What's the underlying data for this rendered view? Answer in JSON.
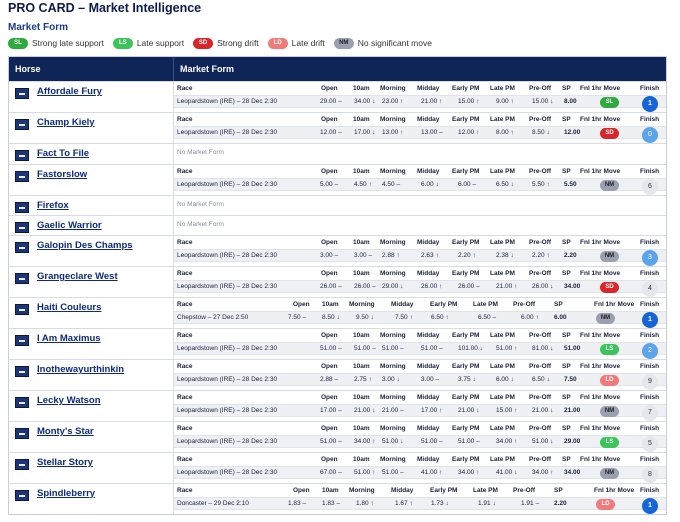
{
  "title": "PRO CARD – Market Intelligence",
  "subtitle": "Market Form",
  "legend": [
    {
      "code": "SL",
      "label": "Strong late support"
    },
    {
      "code": "LS",
      "label": "Late support"
    },
    {
      "code": "SD",
      "label": "Strong drift"
    },
    {
      "code": "LD",
      "label": "Late drift"
    },
    {
      "code": "NM",
      "label": "No significant move"
    }
  ],
  "table": {
    "col_horse": "Horse",
    "col_form": "Market Form",
    "sub_headers": [
      "Race",
      "Open",
      "10am",
      "Morning",
      "Midday",
      "Early PM",
      "Late PM",
      "Pre-Off",
      "SP",
      "Fnl 1hr Move",
      "Finish"
    ],
    "no_form_text": "No Market Form",
    "rows": [
      {
        "horse": "Affordale Fury",
        "race": "Leopardstown (IRE) – 28 Dec 2:30",
        "prices": [
          "29.00 –",
          "34.00 ↓",
          "23.00 ↑",
          "21.00 ↑",
          "15.00 ↑",
          "9.00 ↑",
          "15.00 ↓"
        ],
        "sp": "8.00",
        "move": "SL",
        "finish": "1"
      },
      {
        "horse": "Champ Kiely",
        "race": "Leopardstown (IRE) – 28 Dec 2:30",
        "prices": [
          "12.00 –",
          "17.00 ↓",
          "13.00 ↑",
          "13.00 –",
          "12.00 ↑",
          "8.00 ↑",
          "8.50 ↓"
        ],
        "sp": "12.00",
        "move": "SD",
        "finish": "0"
      },
      {
        "horse": "Fact To File",
        "noform": true
      },
      {
        "horse": "Fastorslow",
        "race": "Leopardstown (IRE) – 28 Dec 2:30",
        "prices": [
          "5.00 –",
          "4.50 ↑",
          "4.50 –",
          "6.00 ↓",
          "6.00 –",
          "6.50 ↓",
          "5.50 ↑"
        ],
        "sp": "5.50",
        "move": "NM",
        "finish": "6"
      },
      {
        "horse": "Firefox",
        "noform": true
      },
      {
        "horse": "Gaelic Warrior",
        "noform": true
      },
      {
        "horse": "Galopin Des Champs",
        "race": "Leopardstown (IRE) – 28 Dec 2:30",
        "prices": [
          "3.00 –",
          "3.00 –",
          "2.88 ↑",
          "2.63 ↑",
          "2.20 ↑",
          "2.38 ↓",
          "2.20 ↑"
        ],
        "sp": "2.20",
        "move": "NM",
        "finish": "3"
      },
      {
        "horse": "Grangeclare West",
        "race": "Leopardstown (IRE) – 28 Dec 2:30",
        "prices": [
          "26.00 –",
          "26.00 –",
          "29.00 ↓",
          "26.00 ↑",
          "26.00 –",
          "21.00 ↑",
          "26.00 ↓"
        ],
        "sp": "34.00",
        "move": "SD",
        "finish": "4"
      },
      {
        "horse": "Haiti Couleurs",
        "race": "Chepstow – 27 Dec 2:50",
        "prices": [
          "7.50 –",
          "8.50 ↓",
          "9.50 ↓",
          "7.50 ↑",
          "6.50 ↑",
          "6.50 –",
          "6.00 ↑"
        ],
        "sp": "6.00",
        "move": "NM",
        "finish": "1",
        "alt": true
      },
      {
        "horse": "I Am Maximus",
        "race": "Leopardstown (IRE) – 28 Dec 2:30",
        "prices": [
          "51.00 –",
          "51.00 –",
          "51.00 –",
          "51.00 –",
          "101.00 ↓",
          "51.00 ↑",
          "81.00 ↓"
        ],
        "sp": "51.00",
        "move": "LS",
        "finish": "2"
      },
      {
        "horse": "Inothewayurthinkin",
        "race": "Leopardstown (IRE) – 28 Dec 2:30",
        "prices": [
          "2.88 –",
          "2.75 ↑",
          "3.00 ↓",
          "3.00 –",
          "3.75 ↓",
          "6.00 ↓",
          "6.50 ↓"
        ],
        "sp": "7.50",
        "move": "LD",
        "finish": "9"
      },
      {
        "horse": "Lecky Watson",
        "race": "Leopardstown (IRE) – 28 Dec 2:30",
        "prices": [
          "17.00 –",
          "21.00 ↓",
          "21.00 –",
          "17.00 ↑",
          "21.00 ↓",
          "15.00 ↑",
          "21.00 ↓"
        ],
        "sp": "21.00",
        "move": "NM",
        "finish": "7"
      },
      {
        "horse": "Monty's Star",
        "race": "Leopardstown (IRE) – 28 Dec 2:30",
        "prices": [
          "51.00 –",
          "34.00 ↑",
          "51.00 ↓",
          "51.00 –",
          "51.00 –",
          "34.00 ↑",
          "51.00 ↓"
        ],
        "sp": "29.00",
        "move": "LS",
        "finish": "5"
      },
      {
        "horse": "Stellar Story",
        "race": "Leopardstown (IRE) – 28 Dec 2:30",
        "prices": [
          "67.00 –",
          "51.00 ↑",
          "51.00 –",
          "41.00 ↑",
          "34.00 ↑",
          "41.00 ↓",
          "34.00 ↑"
        ],
        "sp": "34.00",
        "move": "NM",
        "finish": "8"
      },
      {
        "horse": "Spindleberry",
        "race": "Doncaster – 29 Dec 2:10",
        "prices": [
          "1.83 –",
          "1.83 –",
          "1.80 ↑",
          "1.67 ↑",
          "1.73 ↓",
          "1.91 ↓",
          "1.91 –"
        ],
        "sp": "2.20",
        "move": "LD",
        "finish": "1",
        "alt": true
      }
    ]
  },
  "colors": {
    "header_bg": "#0f2558",
    "link": "#0d2a80",
    "SL": "#2eaa3f",
    "LS": "#3bc45a",
    "SD": "#d9262a",
    "LD": "#ef7b7b",
    "NM": "#9aa0b0"
  }
}
